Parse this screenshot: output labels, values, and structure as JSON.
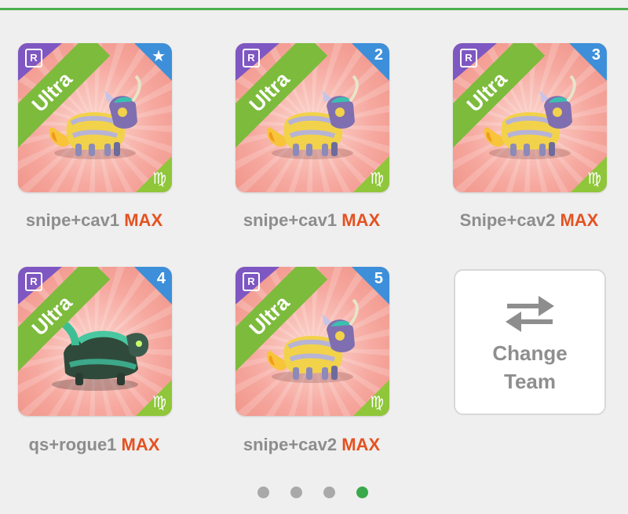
{
  "cards": [
    {
      "slot": "★",
      "rarity_letter": "R",
      "tier": "Ultra",
      "element_sign": "♍",
      "name": "snipe+cav1",
      "level": "MAX",
      "monster": "cat"
    },
    {
      "slot": "2",
      "rarity_letter": "R",
      "tier": "Ultra",
      "element_sign": "♍",
      "name": "snipe+cav1",
      "level": "MAX",
      "monster": "cat"
    },
    {
      "slot": "3",
      "rarity_letter": "R",
      "tier": "Ultra",
      "element_sign": "♍",
      "name": "Snipe+cav2",
      "level": "MAX",
      "monster": "cat"
    },
    {
      "slot": "4",
      "rarity_letter": "R",
      "tier": "Ultra",
      "element_sign": "♍",
      "name": "qs+rogue1",
      "level": "MAX",
      "monster": "dark-beast"
    },
    {
      "slot": "5",
      "rarity_letter": "R",
      "tier": "Ultra",
      "element_sign": "♍",
      "name": "snipe+cav2",
      "level": "MAX",
      "monster": "cat"
    }
  ],
  "change_team": {
    "line1": "Change",
    "line2": "Team",
    "icon": "swap-arrows-icon"
  },
  "pagination": {
    "total": 4,
    "active_index": 3
  },
  "colors": {
    "tier_ribbon": "#7dbb3c",
    "rarity_corner": "#7e57c2",
    "slot_corner": "#3d8fd9",
    "max_text": "#e45221",
    "active_dot": "#3aa94b"
  }
}
